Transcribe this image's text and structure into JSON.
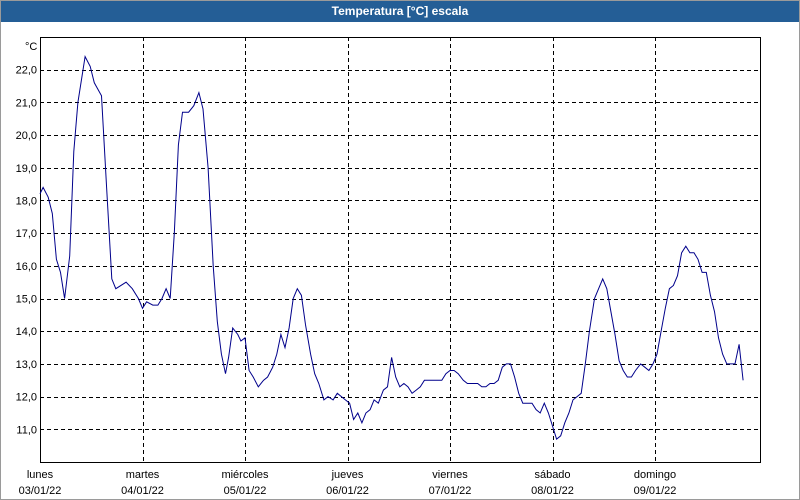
{
  "window": {
    "title": "Temperatura [°C] escala"
  },
  "colors": {
    "titlebar": "#245e96",
    "series": "#00008b",
    "grid": "#000000"
  },
  "chart_data": {
    "type": "line",
    "title": "Temperatura [°C] escala",
    "yunit": "°C",
    "ylim": [
      10.0,
      23.0
    ],
    "yticks": [
      "22,0",
      "21,0",
      "20,0",
      "19,0",
      "18,0",
      "17,0",
      "16,0",
      "15,0",
      "14,0",
      "13,0",
      "12,0",
      "11,0"
    ],
    "ytick_values": [
      22,
      21,
      20,
      19,
      18,
      17,
      16,
      15,
      14,
      13,
      12,
      11
    ],
    "xlim": [
      0,
      7
    ],
    "xtick_days": [
      "lunes",
      "martes",
      "miércoles",
      "jueves",
      "viernes",
      "sábado",
      "domingo"
    ],
    "xtick_dates": [
      "03/01/22",
      "04/01/22",
      "05/01/22",
      "06/01/22",
      "07/01/22",
      "08/01/22",
      "09/01/22"
    ],
    "grid": true,
    "series": [
      {
        "values": [
          [
            0.0,
            18.2
          ],
          [
            0.03,
            18.4
          ],
          [
            0.08,
            18.1
          ],
          [
            0.12,
            17.6
          ],
          [
            0.16,
            16.2
          ],
          [
            0.2,
            15.8
          ],
          [
            0.24,
            15.0
          ],
          [
            0.29,
            16.3
          ],
          [
            0.33,
            19.5
          ],
          [
            0.37,
            21.0
          ],
          [
            0.44,
            22.4
          ],
          [
            0.49,
            22.1
          ],
          [
            0.53,
            21.6
          ],
          [
            0.6,
            21.2
          ],
          [
            0.65,
            18.4
          ],
          [
            0.7,
            15.6
          ],
          [
            0.74,
            15.3
          ],
          [
            0.84,
            15.5
          ],
          [
            0.9,
            15.3
          ],
          [
            0.96,
            15.0
          ],
          [
            1.0,
            14.7
          ],
          [
            1.04,
            14.9
          ],
          [
            1.1,
            14.8
          ],
          [
            1.15,
            14.8
          ],
          [
            1.19,
            15.0
          ],
          [
            1.23,
            15.3
          ],
          [
            1.27,
            15.0
          ],
          [
            1.31,
            17.0
          ],
          [
            1.35,
            19.7
          ],
          [
            1.39,
            20.7
          ],
          [
            1.45,
            20.7
          ],
          [
            1.5,
            20.9
          ],
          [
            1.55,
            21.3
          ],
          [
            1.59,
            20.8
          ],
          [
            1.64,
            19.0
          ],
          [
            1.69,
            16.0
          ],
          [
            1.73,
            14.3
          ],
          [
            1.77,
            13.3
          ],
          [
            1.81,
            12.7
          ],
          [
            1.84,
            13.2
          ],
          [
            1.88,
            14.1
          ],
          [
            1.93,
            13.9
          ],
          [
            1.96,
            13.7
          ],
          [
            2.0,
            13.8
          ],
          [
            2.04,
            12.8
          ],
          [
            2.08,
            12.6
          ],
          [
            2.13,
            12.3
          ],
          [
            2.18,
            12.5
          ],
          [
            2.22,
            12.6
          ],
          [
            2.27,
            12.9
          ],
          [
            2.31,
            13.3
          ],
          [
            2.35,
            13.9
          ],
          [
            2.39,
            13.5
          ],
          [
            2.43,
            14.1
          ],
          [
            2.47,
            15.0
          ],
          [
            2.51,
            15.3
          ],
          [
            2.55,
            15.1
          ],
          [
            2.59,
            14.2
          ],
          [
            2.64,
            13.3
          ],
          [
            2.68,
            12.7
          ],
          [
            2.72,
            12.4
          ],
          [
            2.77,
            11.9
          ],
          [
            2.81,
            12.0
          ],
          [
            2.86,
            11.9
          ],
          [
            2.9,
            12.1
          ],
          [
            2.94,
            12.0
          ],
          [
            2.98,
            11.9
          ],
          [
            3.02,
            11.8
          ],
          [
            3.06,
            11.3
          ],
          [
            3.1,
            11.5
          ],
          [
            3.14,
            11.2
          ],
          [
            3.18,
            11.5
          ],
          [
            3.22,
            11.6
          ],
          [
            3.26,
            11.9
          ],
          [
            3.3,
            11.8
          ],
          [
            3.35,
            12.2
          ],
          [
            3.39,
            12.3
          ],
          [
            3.43,
            13.2
          ],
          [
            3.47,
            12.6
          ],
          [
            3.51,
            12.3
          ],
          [
            3.55,
            12.4
          ],
          [
            3.59,
            12.3
          ],
          [
            3.63,
            12.1
          ],
          [
            3.67,
            12.2
          ],
          [
            3.71,
            12.3
          ],
          [
            3.75,
            12.5
          ],
          [
            3.8,
            12.5
          ],
          [
            3.86,
            12.5
          ],
          [
            3.92,
            12.5
          ],
          [
            3.96,
            12.7
          ],
          [
            4.0,
            12.8
          ],
          [
            4.04,
            12.8
          ],
          [
            4.08,
            12.7
          ],
          [
            4.13,
            12.5
          ],
          [
            4.17,
            12.4
          ],
          [
            4.22,
            12.4
          ],
          [
            4.27,
            12.4
          ],
          [
            4.31,
            12.3
          ],
          [
            4.35,
            12.3
          ],
          [
            4.39,
            12.4
          ],
          [
            4.43,
            12.4
          ],
          [
            4.47,
            12.5
          ],
          [
            4.51,
            12.9
          ],
          [
            4.55,
            13.0
          ],
          [
            4.59,
            13.0
          ],
          [
            4.63,
            12.6
          ],
          [
            4.67,
            12.1
          ],
          [
            4.71,
            11.8
          ],
          [
            4.75,
            11.8
          ],
          [
            4.8,
            11.8
          ],
          [
            4.84,
            11.6
          ],
          [
            4.88,
            11.5
          ],
          [
            4.92,
            11.8
          ],
          [
            4.96,
            11.5
          ],
          [
            5.0,
            11.1
          ],
          [
            5.04,
            10.7
          ],
          [
            5.08,
            10.8
          ],
          [
            5.12,
            11.2
          ],
          [
            5.16,
            11.5
          ],
          [
            5.2,
            11.9
          ],
          [
            5.24,
            12.0
          ],
          [
            5.28,
            12.1
          ],
          [
            5.32,
            13.0
          ],
          [
            5.36,
            14.0
          ],
          [
            5.41,
            15.0
          ],
          [
            5.45,
            15.3
          ],
          [
            5.49,
            15.6
          ],
          [
            5.53,
            15.3
          ],
          [
            5.57,
            14.6
          ],
          [
            5.61,
            13.9
          ],
          [
            5.65,
            13.1
          ],
          [
            5.69,
            12.8
          ],
          [
            5.73,
            12.6
          ],
          [
            5.77,
            12.6
          ],
          [
            5.81,
            12.8
          ],
          [
            5.86,
            13.0
          ],
          [
            5.9,
            12.9
          ],
          [
            5.94,
            12.8
          ],
          [
            5.98,
            13.0
          ],
          [
            6.02,
            13.3
          ],
          [
            6.06,
            14.0
          ],
          [
            6.1,
            14.7
          ],
          [
            6.14,
            15.3
          ],
          [
            6.18,
            15.4
          ],
          [
            6.22,
            15.7
          ],
          [
            6.26,
            16.4
          ],
          [
            6.3,
            16.6
          ],
          [
            6.34,
            16.4
          ],
          [
            6.38,
            16.4
          ],
          [
            6.42,
            16.2
          ],
          [
            6.46,
            15.8
          ],
          [
            6.5,
            15.8
          ],
          [
            6.54,
            15.1
          ],
          [
            6.58,
            14.6
          ],
          [
            6.62,
            13.8
          ],
          [
            6.66,
            13.3
          ],
          [
            6.7,
            13.0
          ],
          [
            6.74,
            13.0
          ],
          [
            6.78,
            13.0
          ],
          [
            6.82,
            13.6
          ],
          [
            6.86,
            12.5
          ]
        ]
      }
    ]
  }
}
